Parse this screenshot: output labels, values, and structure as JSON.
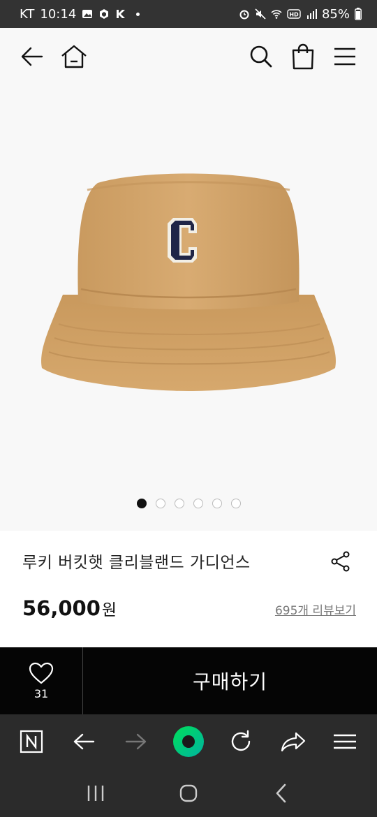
{
  "status_bar": {
    "carrier": "KT",
    "time": "10:14",
    "battery": "85%",
    "icons": [
      "gallery-icon",
      "box-icon",
      "k-app-icon",
      "dot",
      "alarm-icon",
      "mute-icon",
      "wifi-icon",
      "hd-icon",
      "signal-icon",
      "battery-icon"
    ]
  },
  "header": {
    "icons": [
      "back-arrow-icon",
      "home-icon",
      "search-icon",
      "shopping-bag-icon",
      "menu-icon"
    ]
  },
  "product": {
    "image": "beige bucket hat with navy C logo",
    "carousel": {
      "count": 6,
      "active_index": 0
    },
    "title": "루키 버킷햇 클리블랜드 가디언스",
    "price": "56,000",
    "price_unit": "원",
    "reviews_link": "695개 리뷰보기"
  },
  "buy_bar": {
    "like_count": "31",
    "buy_label": "구매하기"
  },
  "browser_toolbar": {
    "icons": [
      "naver-n-icon",
      "back-icon",
      "forward-icon",
      "green-home-icon",
      "refresh-icon",
      "share-icon",
      "menu-icon"
    ]
  },
  "system_nav": {
    "icons": [
      "recent-apps-icon",
      "home-icon",
      "back-icon"
    ]
  },
  "colors": {
    "hat": "#d3a56b",
    "logo_navy": "#1f2547",
    "buy_bar_bg": "#050505",
    "toolbar_bg": "#2b2b2b",
    "accent_green": "#00c776"
  }
}
